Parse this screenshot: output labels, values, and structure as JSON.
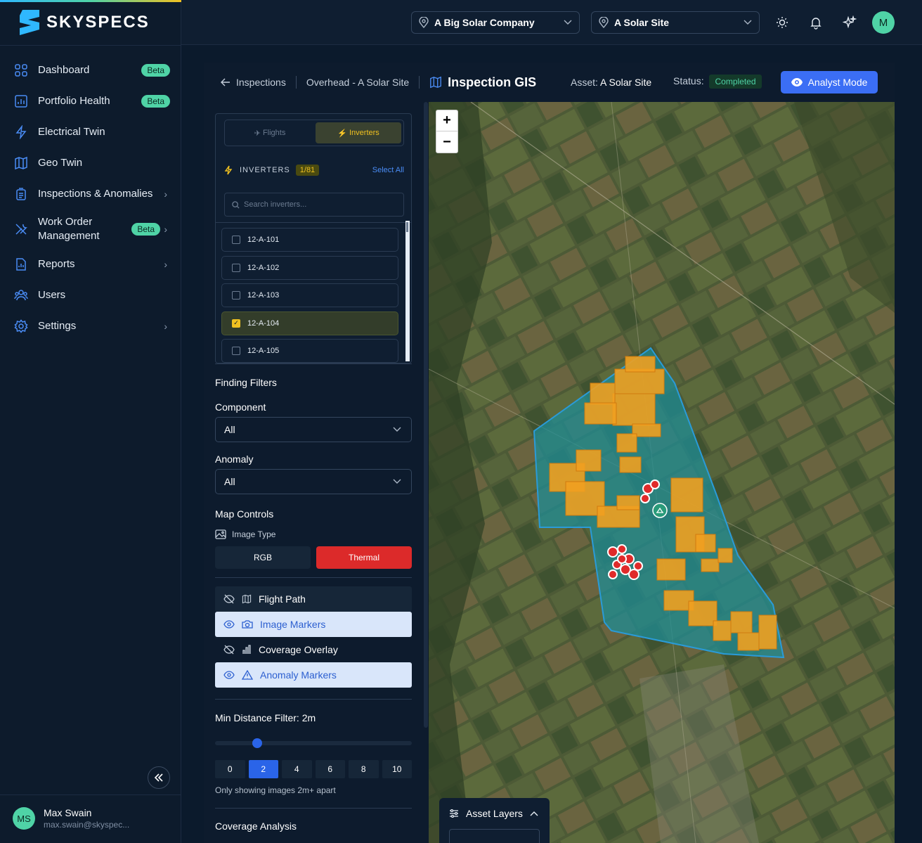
{
  "brand": {
    "name": "SKYSPECS"
  },
  "sidebar": {
    "items": [
      {
        "label": "Dashboard",
        "badge": "Beta",
        "icon": "grid-icon"
      },
      {
        "label": "Portfolio Health",
        "badge": "Beta",
        "icon": "bar-chart-icon"
      },
      {
        "label": "Electrical Twin",
        "icon": "lightning-icon"
      },
      {
        "label": "Geo Twin",
        "icon": "map-icon"
      },
      {
        "label": "Inspections & Anomalies",
        "icon": "clipboard-icon",
        "has_children": true
      },
      {
        "label": "Work Order Management",
        "badge": "Beta",
        "icon": "tools-icon",
        "has_children": true
      },
      {
        "label": "Reports",
        "icon": "report-icon",
        "has_children": true
      },
      {
        "label": "Users",
        "icon": "users-icon"
      },
      {
        "label": "Settings",
        "icon": "gear-icon",
        "has_children": true
      }
    ],
    "user": {
      "initials": "MS",
      "name": "Max Swain",
      "email": "max.swain@skyspec..."
    }
  },
  "header": {
    "company": "A Big Solar Company",
    "site": "A Solar Site",
    "avatar_initial": "M"
  },
  "breadcrumb": {
    "back": "Inspections",
    "parent": "Overhead - A Solar Site",
    "title": "Inspection GIS"
  },
  "meta": {
    "asset_label": "Asset:",
    "asset_value": "A Solar Site",
    "status_label": "Status:",
    "status_value": "Completed",
    "analyst_button": "Analyst Mode"
  },
  "inverter_panel": {
    "tabs": [
      "Flights",
      "Inverters"
    ],
    "active_tab": "Inverters",
    "heading": "INVERTERS",
    "count": "1/81",
    "select_all": "Select All",
    "search_placeholder": "Search inverters...",
    "items": [
      {
        "label": "12-A-101",
        "checked": false
      },
      {
        "label": "12-A-102",
        "checked": false
      },
      {
        "label": "12-A-103",
        "checked": false
      },
      {
        "label": "12-A-104",
        "checked": true
      },
      {
        "label": "12-A-105",
        "checked": false
      }
    ]
  },
  "filters": {
    "title": "Finding Filters",
    "component_label": "Component",
    "component_value": "All",
    "anomaly_label": "Anomaly",
    "anomaly_value": "All"
  },
  "map_controls": {
    "title": "Map Controls",
    "image_type_label": "Image Type",
    "rgb": "RGB",
    "thermal": "Thermal",
    "active_image_type": "Thermal",
    "layers": [
      {
        "label": "Flight Path",
        "visible": false
      },
      {
        "label": "Image Markers",
        "visible": true
      },
      {
        "label": "Coverage Overlay",
        "visible": false
      },
      {
        "label": "Anomaly Markers",
        "visible": true
      }
    ]
  },
  "distance_filter": {
    "title": "Min Distance Filter: 2m",
    "steps": [
      "0",
      "2",
      "4",
      "6",
      "8",
      "10"
    ],
    "selected": "2",
    "note": "Only showing images 2m+ apart"
  },
  "coverage": {
    "title": "Coverage Analysis"
  },
  "map": {
    "zoom_in": "+",
    "zoom_out": "−",
    "asset_layers_title": "Asset Layers"
  },
  "colors": {
    "accent": "#3b6ef5",
    "brand_green": "#4fd3a6",
    "inverter_yellow": "#f0c020",
    "thermal_red": "#dc2a2a",
    "panel_orange": "#f0a020",
    "site_teal": "#2a8f95"
  }
}
